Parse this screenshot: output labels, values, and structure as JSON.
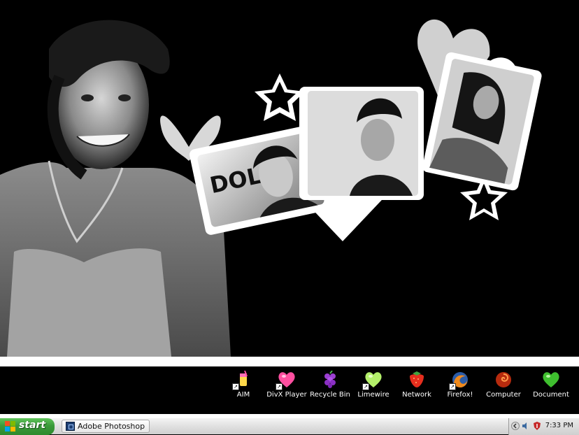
{
  "desktop_icons": [
    {
      "label": "AIM",
      "icon": "aim-icon"
    },
    {
      "label": "DivX Player",
      "icon": "divx-heart-icon"
    },
    {
      "label": "Recycle Bin",
      "icon": "grapes-recycle-icon"
    },
    {
      "label": "Limewire",
      "icon": "lime-heart-icon"
    },
    {
      "label": "Network",
      "icon": "strawberry-network-icon"
    },
    {
      "label": "Firefox!",
      "icon": "firefox-icon"
    },
    {
      "label": "Computer",
      "icon": "computer-swirl-icon"
    },
    {
      "label": "Document",
      "icon": "green-heart-document-icon"
    }
  ],
  "taskbar": {
    "start_label": "start",
    "open_window": "Adobe Photoshop",
    "clock": "7:33 PM"
  },
  "colors": {
    "taskbar_green": "#3a9a3a",
    "desktop_bg": "#000000"
  }
}
